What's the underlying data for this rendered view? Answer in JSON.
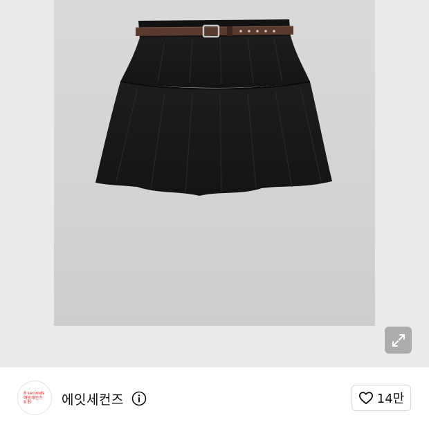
{
  "gallery": {
    "image_alt": "black tiered mini skirt with brown belt",
    "expand_icon": "expand-arrows-icon"
  },
  "store": {
    "logo_lines": [
      "8 seconds",
      "에잇세컨즈",
      "8 秒"
    ],
    "name": "에잇세컨즈",
    "info_icon": "info-icon"
  },
  "like": {
    "icon": "heart-icon",
    "count": "14만"
  }
}
